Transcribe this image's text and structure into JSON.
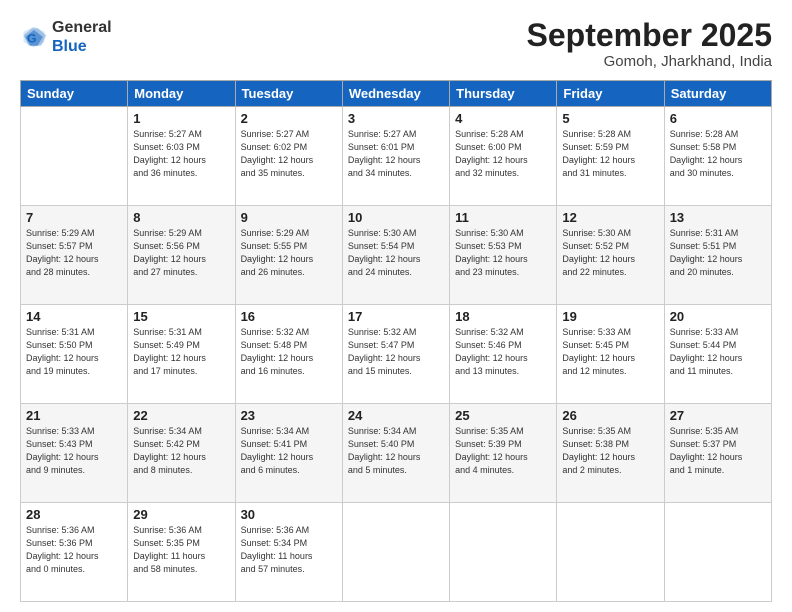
{
  "header": {
    "logo_line1": "General",
    "logo_line2": "Blue",
    "month": "September 2025",
    "location": "Gomoh, Jharkhand, India"
  },
  "weekdays": [
    "Sunday",
    "Monday",
    "Tuesday",
    "Wednesday",
    "Thursday",
    "Friday",
    "Saturday"
  ],
  "weeks": [
    [
      {
        "day": "",
        "info": ""
      },
      {
        "day": "1",
        "info": "Sunrise: 5:27 AM\nSunset: 6:03 PM\nDaylight: 12 hours\nand 36 minutes."
      },
      {
        "day": "2",
        "info": "Sunrise: 5:27 AM\nSunset: 6:02 PM\nDaylight: 12 hours\nand 35 minutes."
      },
      {
        "day": "3",
        "info": "Sunrise: 5:27 AM\nSunset: 6:01 PM\nDaylight: 12 hours\nand 34 minutes."
      },
      {
        "day": "4",
        "info": "Sunrise: 5:28 AM\nSunset: 6:00 PM\nDaylight: 12 hours\nand 32 minutes."
      },
      {
        "day": "5",
        "info": "Sunrise: 5:28 AM\nSunset: 5:59 PM\nDaylight: 12 hours\nand 31 minutes."
      },
      {
        "day": "6",
        "info": "Sunrise: 5:28 AM\nSunset: 5:58 PM\nDaylight: 12 hours\nand 30 minutes."
      }
    ],
    [
      {
        "day": "7",
        "info": "Sunrise: 5:29 AM\nSunset: 5:57 PM\nDaylight: 12 hours\nand 28 minutes."
      },
      {
        "day": "8",
        "info": "Sunrise: 5:29 AM\nSunset: 5:56 PM\nDaylight: 12 hours\nand 27 minutes."
      },
      {
        "day": "9",
        "info": "Sunrise: 5:29 AM\nSunset: 5:55 PM\nDaylight: 12 hours\nand 26 minutes."
      },
      {
        "day": "10",
        "info": "Sunrise: 5:30 AM\nSunset: 5:54 PM\nDaylight: 12 hours\nand 24 minutes."
      },
      {
        "day": "11",
        "info": "Sunrise: 5:30 AM\nSunset: 5:53 PM\nDaylight: 12 hours\nand 23 minutes."
      },
      {
        "day": "12",
        "info": "Sunrise: 5:30 AM\nSunset: 5:52 PM\nDaylight: 12 hours\nand 22 minutes."
      },
      {
        "day": "13",
        "info": "Sunrise: 5:31 AM\nSunset: 5:51 PM\nDaylight: 12 hours\nand 20 minutes."
      }
    ],
    [
      {
        "day": "14",
        "info": "Sunrise: 5:31 AM\nSunset: 5:50 PM\nDaylight: 12 hours\nand 19 minutes."
      },
      {
        "day": "15",
        "info": "Sunrise: 5:31 AM\nSunset: 5:49 PM\nDaylight: 12 hours\nand 17 minutes."
      },
      {
        "day": "16",
        "info": "Sunrise: 5:32 AM\nSunset: 5:48 PM\nDaylight: 12 hours\nand 16 minutes."
      },
      {
        "day": "17",
        "info": "Sunrise: 5:32 AM\nSunset: 5:47 PM\nDaylight: 12 hours\nand 15 minutes."
      },
      {
        "day": "18",
        "info": "Sunrise: 5:32 AM\nSunset: 5:46 PM\nDaylight: 12 hours\nand 13 minutes."
      },
      {
        "day": "19",
        "info": "Sunrise: 5:33 AM\nSunset: 5:45 PM\nDaylight: 12 hours\nand 12 minutes."
      },
      {
        "day": "20",
        "info": "Sunrise: 5:33 AM\nSunset: 5:44 PM\nDaylight: 12 hours\nand 11 minutes."
      }
    ],
    [
      {
        "day": "21",
        "info": "Sunrise: 5:33 AM\nSunset: 5:43 PM\nDaylight: 12 hours\nand 9 minutes."
      },
      {
        "day": "22",
        "info": "Sunrise: 5:34 AM\nSunset: 5:42 PM\nDaylight: 12 hours\nand 8 minutes."
      },
      {
        "day": "23",
        "info": "Sunrise: 5:34 AM\nSunset: 5:41 PM\nDaylight: 12 hours\nand 6 minutes."
      },
      {
        "day": "24",
        "info": "Sunrise: 5:34 AM\nSunset: 5:40 PM\nDaylight: 12 hours\nand 5 minutes."
      },
      {
        "day": "25",
        "info": "Sunrise: 5:35 AM\nSunset: 5:39 PM\nDaylight: 12 hours\nand 4 minutes."
      },
      {
        "day": "26",
        "info": "Sunrise: 5:35 AM\nSunset: 5:38 PM\nDaylight: 12 hours\nand 2 minutes."
      },
      {
        "day": "27",
        "info": "Sunrise: 5:35 AM\nSunset: 5:37 PM\nDaylight: 12 hours\nand 1 minute."
      }
    ],
    [
      {
        "day": "28",
        "info": "Sunrise: 5:36 AM\nSunset: 5:36 PM\nDaylight: 12 hours\nand 0 minutes."
      },
      {
        "day": "29",
        "info": "Sunrise: 5:36 AM\nSunset: 5:35 PM\nDaylight: 11 hours\nand 58 minutes."
      },
      {
        "day": "30",
        "info": "Sunrise: 5:36 AM\nSunset: 5:34 PM\nDaylight: 11 hours\nand 57 minutes."
      },
      {
        "day": "",
        "info": ""
      },
      {
        "day": "",
        "info": ""
      },
      {
        "day": "",
        "info": ""
      },
      {
        "day": "",
        "info": ""
      }
    ]
  ]
}
